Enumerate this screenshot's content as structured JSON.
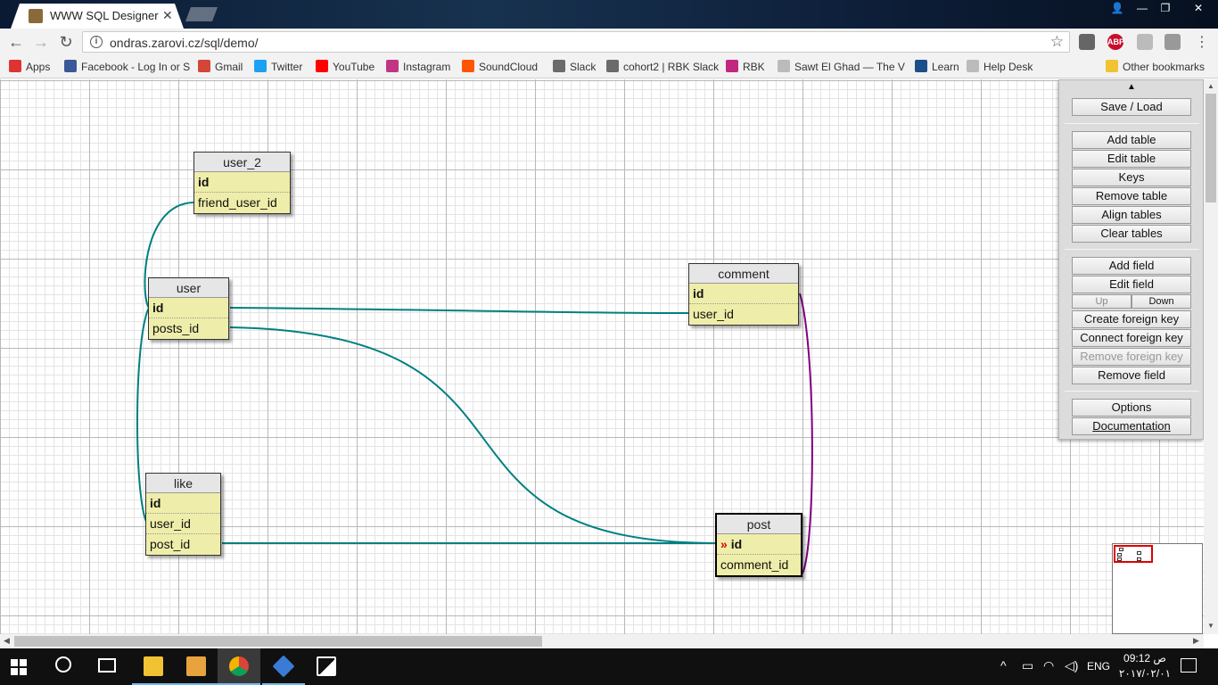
{
  "browser": {
    "tab_title": "WWW SQL Designer",
    "tab_close": "✕",
    "url": "ondras.zarovi.cz/sql/demo/",
    "abp_label": "ABP",
    "bookmarks": [
      {
        "label": "Apps",
        "color": "#d33"
      },
      {
        "label": "Facebook - Log In or S",
        "color": "#3b5998"
      },
      {
        "label": "Gmail",
        "color": "#d44638"
      },
      {
        "label": "Twitter",
        "color": "#1da1f2"
      },
      {
        "label": "YouTube",
        "color": "#ff0000"
      },
      {
        "label": "Instagram",
        "color": "#c13584"
      },
      {
        "label": "SoundCloud",
        "color": "#ff5500"
      },
      {
        "label": "Slack",
        "color": "#6b6b6b"
      },
      {
        "label": "cohort2 | RBK Slack",
        "color": "#6b6b6b"
      },
      {
        "label": "RBK",
        "color": "#c0277e"
      },
      {
        "label": "Sawt El Ghad — The V",
        "color": "#bbbbbb"
      },
      {
        "label": "Learn",
        "color": "#1a4f8a"
      },
      {
        "label": "Help Desk",
        "color": "#bbbbbb"
      }
    ],
    "other_bookmarks": "Other bookmarks"
  },
  "designer": {
    "tables": [
      {
        "name": "user_2",
        "fields": [
          {
            "name": "id",
            "pk": true
          },
          {
            "name": "friend_user_id",
            "pk": false
          }
        ]
      },
      {
        "name": "user",
        "fields": [
          {
            "name": "id",
            "pk": true
          },
          {
            "name": "posts_id",
            "pk": false
          }
        ]
      },
      {
        "name": "comment",
        "fields": [
          {
            "name": "id",
            "pk": true
          },
          {
            "name": "user_id",
            "pk": false
          }
        ]
      },
      {
        "name": "like",
        "fields": [
          {
            "name": "id",
            "pk": true
          },
          {
            "name": "user_id",
            "pk": false
          },
          {
            "name": "post_id",
            "pk": false
          }
        ]
      },
      {
        "name": "post",
        "fields": [
          {
            "name": "id",
            "pk": true,
            "fk_marker": "»"
          },
          {
            "name": "comment_id",
            "pk": false
          }
        ]
      }
    ],
    "relation_colors": {
      "default": "#008080",
      "selected": "#800080"
    }
  },
  "controls": {
    "toggle": "▲",
    "save_load": "Save / Load",
    "add_table": "Add table",
    "edit_table": "Edit table",
    "keys": "Keys",
    "remove_table": "Remove table",
    "align_tables": "Align tables",
    "clear_tables": "Clear tables",
    "add_field": "Add field",
    "edit_field": "Edit field",
    "up": "Up",
    "down": "Down",
    "create_fk": "Create foreign key",
    "connect_fk": "Connect foreign key",
    "remove_fk": "Remove foreign key",
    "remove_field": "Remove field",
    "options": "Options",
    "documentation": "Documentation"
  },
  "taskbar": {
    "lang": "ENG",
    "time": "09:12 ص",
    "date": "٢٠١٧/٠٢/٠١"
  }
}
